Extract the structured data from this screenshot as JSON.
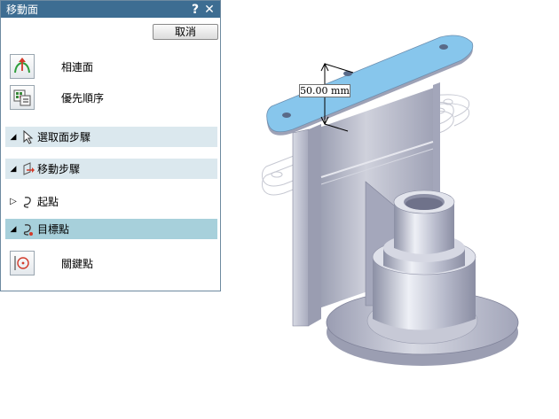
{
  "dialog": {
    "title": "移動面",
    "help_label": "?",
    "close_label": "✕",
    "cancel_label": "取消",
    "tools": [
      {
        "label": "相連面",
        "icon": "connected-faces-icon"
      },
      {
        "label": "優先順序",
        "icon": "priority-order-icon"
      }
    ],
    "sections": {
      "select_faces": "選取面步驟",
      "move_steps": "移動步驟",
      "start_point": "起點",
      "target_point": "目標點"
    },
    "keypoint_label": "關鍵點"
  },
  "viewport": {
    "dimension_label": "50.00 mm",
    "highlight_color": "#87c6ec",
    "model_color": "#b9bcce"
  }
}
